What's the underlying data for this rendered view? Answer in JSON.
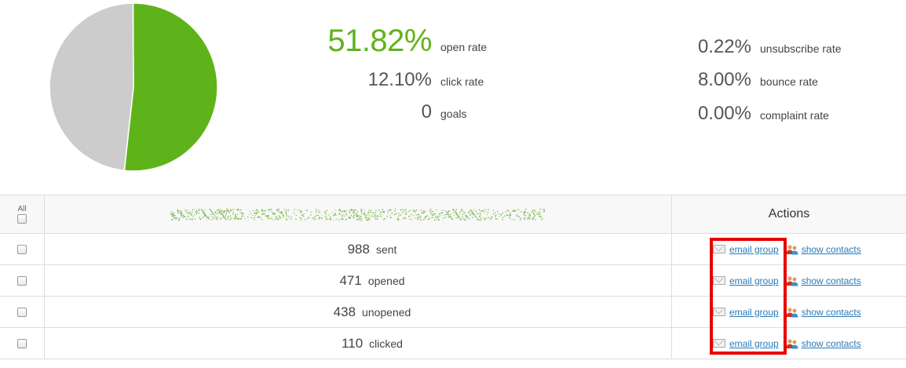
{
  "chart_data": {
    "type": "pie",
    "slices": [
      {
        "label": "opened",
        "value": 51.82,
        "color": "#5fb31a"
      },
      {
        "label": "unopened",
        "value": 48.18,
        "color": "#cccccc"
      }
    ]
  },
  "stats": {
    "open_rate": {
      "value": "51.82%",
      "label": "open rate"
    },
    "click_rate": {
      "value": "12.10%",
      "label": "click rate"
    },
    "goals": {
      "value": "0",
      "label": "goals"
    },
    "unsubscribe_rate": {
      "value": "0.22%",
      "label": "unsubscribe rate"
    },
    "bounce_rate": {
      "value": "8.00%",
      "label": "bounce rate"
    },
    "complaint_rate": {
      "value": "0.00%",
      "label": "complaint rate"
    }
  },
  "table": {
    "select_all_label": "All",
    "actions_header": "Actions",
    "rows": [
      {
        "count": "988",
        "label": "sent"
      },
      {
        "count": "471",
        "label": "opened"
      },
      {
        "count": "438",
        "label": "unopened"
      },
      {
        "count": "110",
        "label": "clicked"
      }
    ],
    "email_group_label": "email group",
    "show_contacts_label": "show contacts"
  },
  "colors": {
    "accent": "#5fb31a",
    "link": "#2a7ab8",
    "highlight": "#e80000"
  }
}
